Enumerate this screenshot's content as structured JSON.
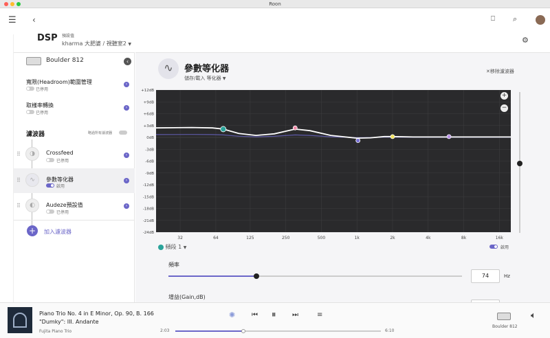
{
  "window": {
    "title": "Roon"
  },
  "header": {
    "title": "DSP",
    "preset_label": "預設值",
    "preset_value": "kharma 大肥婆 / 視聽室2"
  },
  "sidebar": {
    "device": "Boulder 812",
    "items": [
      {
        "title": "寬限(Headroom)範圍管理",
        "status": "已停用"
      },
      {
        "title": "取樣率轉換",
        "status": "已停用"
      }
    ],
    "filters_heading": "濾波器",
    "bypass_label": "略過所有濾波器",
    "filters": [
      {
        "title": "Crossfeed",
        "status": "已停用",
        "on": false
      },
      {
        "title": "參數等化器",
        "status": "啟用",
        "on": true
      },
      {
        "title": "Audeze預設值",
        "status": "已停用",
        "on": false
      }
    ],
    "add_filter": "加入濾波器"
  },
  "main": {
    "title": "參數等化器",
    "save_load": "儲存/載入 等化器",
    "remove": "移除濾波器",
    "band_label": "頻段 1",
    "enabled_label": "啟用",
    "freq_label": "頻率",
    "freq_value": "74",
    "freq_unit": "Hz",
    "freq_slider_fraction": 0.3,
    "gain_label": "增益(Gain,dB)"
  },
  "chart_data": {
    "type": "line",
    "y_ticks": [
      "+12dB",
      "+9dB",
      "+6dB",
      "+3dB",
      "0dB",
      "-3dB",
      "-6dB",
      "-9dB",
      "-12dB",
      "-15dB",
      "-18dB",
      "-21dB",
      "-24dB"
    ],
    "x_ticks": [
      "32",
      "64",
      "125",
      "250",
      "500",
      "1k",
      "2k",
      "4k",
      "8k",
      "16k"
    ],
    "ylim": [
      -24,
      12
    ],
    "xlim_hz": [
      20,
      20000
    ],
    "curve": {
      "hz": [
        20,
        40,
        60,
        74,
        100,
        140,
        200,
        300,
        400,
        600,
        800,
        1000,
        1300,
        1700,
        2000,
        3000,
        6000,
        12000,
        20000
      ],
      "db": [
        2.4,
        2.5,
        2.4,
        2.1,
        1.0,
        0.5,
        0.9,
        2.1,
        1.7,
        0.5,
        0.1,
        -0.2,
        -0.1,
        0.2,
        0.2,
        0.1,
        0.1,
        0.1,
        0.1
      ]
    },
    "handles": [
      {
        "hz": 74,
        "db": 2.1,
        "color": "#2aa39a"
      },
      {
        "hz": 300,
        "db": 2.4,
        "color": "#f08aa8"
      },
      {
        "hz": 1020,
        "db": -0.8,
        "color": "#7a72d8"
      },
      {
        "hz": 2000,
        "db": 0.2,
        "color": "#f1e25c"
      },
      {
        "hz": 6000,
        "db": 0.2,
        "color": "#b891e8"
      }
    ],
    "accent_color": "#6b66c8"
  },
  "player": {
    "title": "Piano Trio No. 4 in E Minor, Op. 90, B. 166",
    "subtitle": "\"Dumky\": III. Andante",
    "artist": "Fujita Piano Trio",
    "elapsed": "2:03",
    "duration": "6:10",
    "progress_fraction": 0.33,
    "zone": "Boulder 812"
  }
}
